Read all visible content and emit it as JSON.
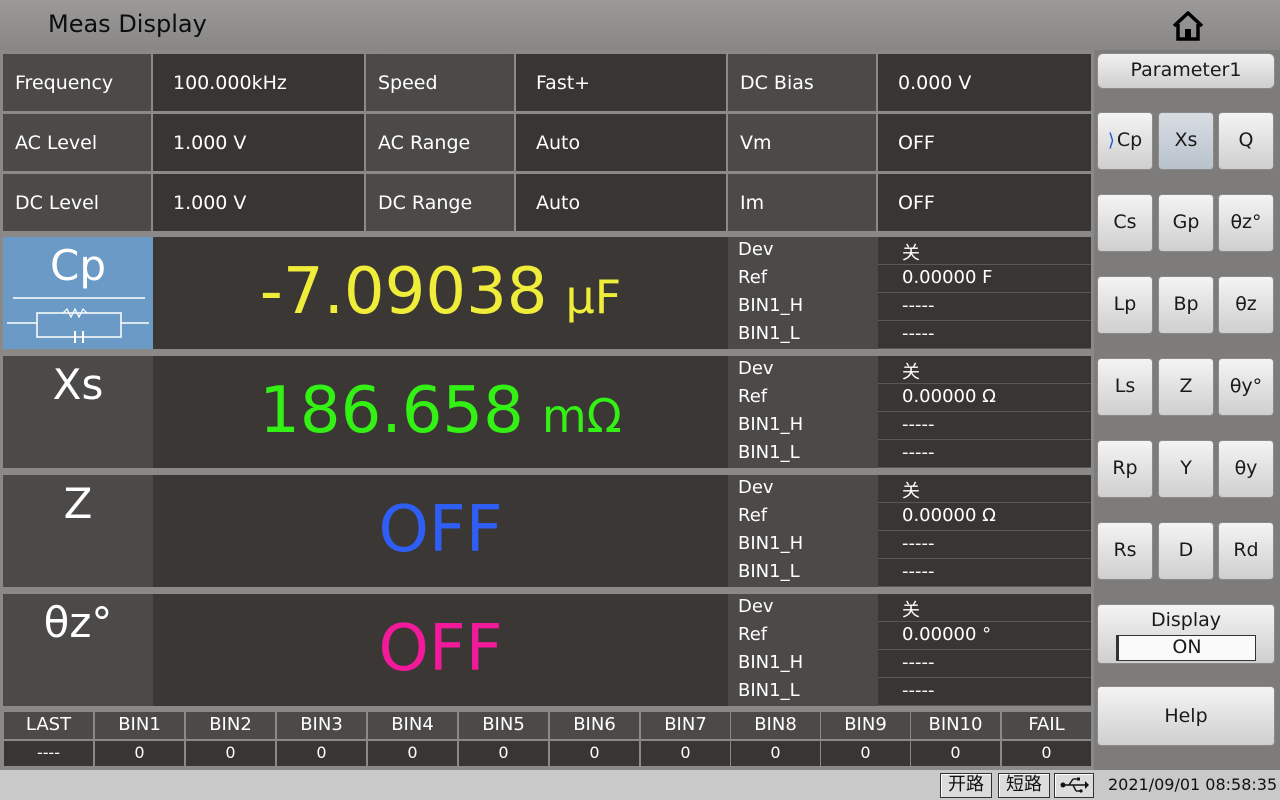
{
  "header": {
    "title": "Meas Display",
    "home_icon": "home-icon"
  },
  "setup": {
    "frequency_label": "Frequency",
    "frequency_value": "100.000kHz",
    "speed_label": "Speed",
    "speed_value": "Fast+",
    "dcbias_label": "DC Bias",
    "dcbias_value": "0.000 V",
    "aclevel_label": "AC Level",
    "aclevel_value": "1.000 V",
    "acrange_label": "AC Range",
    "acrange_value": "Auto",
    "vm_label": "Vm",
    "vm_value": "OFF",
    "dclevel_label": "DC Level",
    "dclevel_value": "1.000 V",
    "dcrange_label": "DC Range",
    "dcrange_value": "Auto",
    "im_label": "Im",
    "im_value": "OFF"
  },
  "measurements": [
    {
      "param": "Cp",
      "value": "-7.09038",
      "unit": "μF",
      "color": "#f0ec3a",
      "dev_label": "Dev",
      "dev_value": "关",
      "ref_label": "Ref",
      "ref_value": "0.00000 F",
      "binh_label": "BIN1_H",
      "binh_value": "-----",
      "binl_label": "BIN1_L",
      "binl_value": "-----"
    },
    {
      "param": "Xs",
      "value": "186.658",
      "unit": "mΩ",
      "color": "#33f015",
      "dev_label": "Dev",
      "dev_value": "关",
      "ref_label": "Ref",
      "ref_value": "0.00000 Ω",
      "binh_label": "BIN1_H",
      "binh_value": "-----",
      "binl_label": "BIN1_L",
      "binl_value": "-----"
    },
    {
      "param": "Z",
      "value": "OFF",
      "unit": "",
      "color": "#2f5ef5",
      "dev_label": "Dev",
      "dev_value": "关",
      "ref_label": "Ref",
      "ref_value": "0.00000 Ω",
      "binh_label": "BIN1_H",
      "binh_value": "-----",
      "binl_label": "BIN1_L",
      "binl_value": "-----"
    },
    {
      "param": "θz°",
      "value": "OFF",
      "unit": "",
      "color": "#f21a9a",
      "dev_label": "Dev",
      "dev_value": "关",
      "ref_label": "Ref",
      "ref_value": "0.00000 °",
      "binh_label": "BIN1_H",
      "binh_value": "-----",
      "binl_label": "BIN1_L",
      "binl_value": "-----"
    }
  ],
  "bins": [
    {
      "label": "LAST",
      "count": "----"
    },
    {
      "label": "BIN1",
      "count": "0"
    },
    {
      "label": "BIN2",
      "count": "0"
    },
    {
      "label": "BIN3",
      "count": "0"
    },
    {
      "label": "BIN4",
      "count": "0"
    },
    {
      "label": "BIN5",
      "count": "0"
    },
    {
      "label": "BIN6",
      "count": "0"
    },
    {
      "label": "BIN7",
      "count": "0"
    },
    {
      "label": "BIN8",
      "count": "0"
    },
    {
      "label": "BIN9",
      "count": "0"
    },
    {
      "label": "BIN10",
      "count": "0"
    },
    {
      "label": "FAIL",
      "count": "0"
    }
  ],
  "side": {
    "header": "Parameter1",
    "buttons": [
      [
        "Cp",
        "Xs",
        "Q"
      ],
      [
        "Cs",
        "Gp",
        "θz°"
      ],
      [
        "Lp",
        "Bp",
        "θz"
      ],
      [
        "Ls",
        "Z",
        "θy°"
      ],
      [
        "Rp",
        "Y",
        "θy"
      ],
      [
        "Rs",
        "D",
        "Rd"
      ]
    ],
    "selected": "Cp",
    "display_label": "Display",
    "display_value": "ON",
    "help_label": "Help"
  },
  "status": {
    "open_label": "开路",
    "short_label": "短路",
    "usb_icon": "usb-icon",
    "datetime": "2021/09/01 08:58:35"
  },
  "colors": {
    "accent_selected": "#6a9ac5",
    "cp_value": "#f0ec3a",
    "xs_value": "#33f015",
    "z_value": "#2f5ef5",
    "theta_value": "#f21a9a"
  }
}
